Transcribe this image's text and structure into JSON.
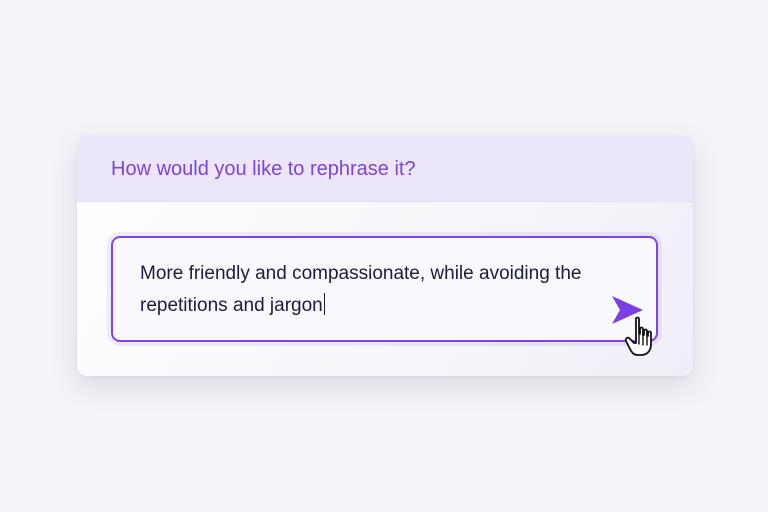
{
  "prompt": {
    "title": "How would you like to rephrase it?",
    "input_value": "More friendly and compassionate, while avoiding the repetitions and jargon"
  },
  "send_button": {
    "icon": "send-arrow-icon",
    "color": "#7b3fe4"
  },
  "pointer": {
    "icon": "hand-pointer-cursor-icon"
  },
  "colors": {
    "accent": "#7d43dc",
    "header_background": "#ece6fa",
    "input_border": "#7f44e3",
    "text": "#1c1d3a",
    "page_background": "#f4f4f8"
  }
}
